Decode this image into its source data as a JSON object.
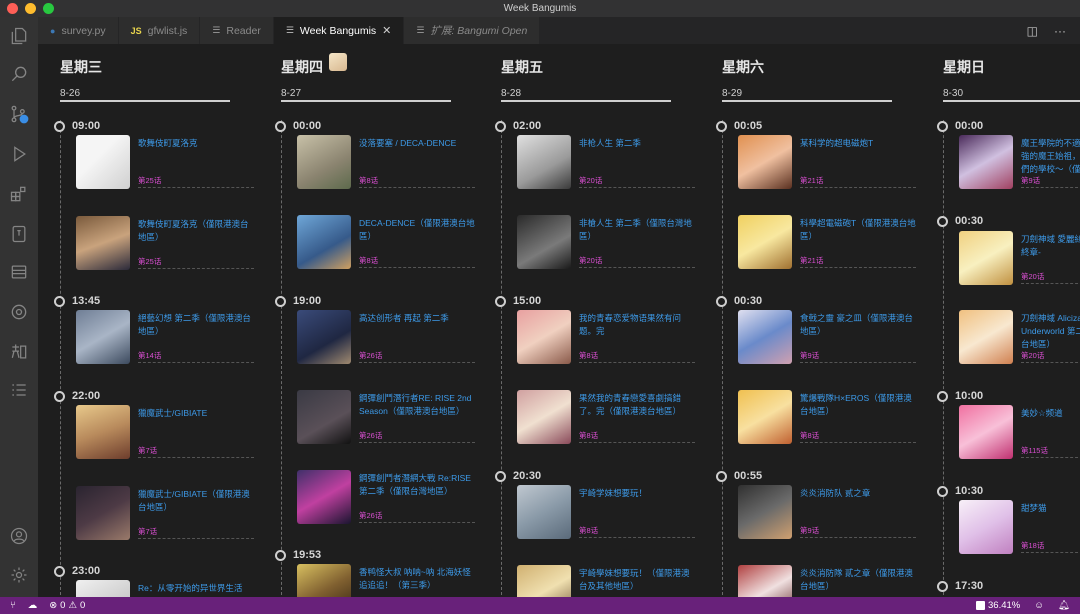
{
  "window": {
    "title": "Week Bangumis"
  },
  "tabs": [
    {
      "label": "survey.py",
      "icon": "python-icon",
      "active": false,
      "italic": false
    },
    {
      "label": "gfwlist.js",
      "icon_text": "JS",
      "active": false,
      "italic": false
    },
    {
      "label": "Reader",
      "icon": "preview-icon",
      "active": false,
      "italic": false
    },
    {
      "label": "Week Bangumis",
      "icon": "preview-icon",
      "active": true,
      "italic": false
    },
    {
      "label": "扩展: Bangumi Open",
      "icon": "preview-icon",
      "active": false,
      "italic": true
    }
  ],
  "days": [
    {
      "name": "星期三",
      "date": "8-26",
      "slots": [
        {
          "time": "09:00",
          "entries": [
            {
              "title": "歌舞伎町夏洛克",
              "ep": "第25话",
              "cover": "c1"
            },
            {
              "title": "歌舞伎町夏洛克（僅限港澳台地區）",
              "ep": "第25话",
              "cover": "c2"
            }
          ]
        },
        {
          "time": "13:45",
          "entries": [
            {
              "title": "絕藝幻想 第二季（僅限港澳台地區）",
              "ep": "第14话",
              "cover": "c3"
            }
          ]
        },
        {
          "time": "22:00",
          "entries": [
            {
              "title": "獵魔武士/GIBIATE",
              "ep": "第7话",
              "cover": "c4"
            },
            {
              "title": "獵魔武士/GIBIATE（僅限港澳台地區）",
              "ep": "第7话",
              "cover": "c5"
            }
          ]
        },
        {
          "time": "23:00",
          "entries": [
            {
              "title": "Re：从零开始的异世界生活",
              "ep": "",
              "cover": "c31"
            }
          ]
        }
      ]
    },
    {
      "name": "星期四",
      "date": "8-27",
      "slots": [
        {
          "time": "00:00",
          "entries": [
            {
              "title": "没落要塞 / DECA-DENCE",
              "ep": "第8话",
              "cover": "c6"
            },
            {
              "title": "DECA-DENCE（僅限港澳台地區）",
              "ep": "第8话",
              "cover": "c7"
            }
          ]
        },
        {
          "time": "19:00",
          "entries": [
            {
              "title": "高达创形者 再起 第二季",
              "ep": "第26话",
              "cover": "c8"
            },
            {
              "title": "鋼彈創鬥潛行者RE: RISE 2nd Season（僅限港澳台地區）",
              "ep": "第26话",
              "cover": "c9"
            },
            {
              "title": "鋼彈創鬥者潛網大戰 Re:RISE 第二季（僅限台灣地區）",
              "ep": "第26话",
              "cover": "c10"
            }
          ]
        },
        {
          "time": "19:53",
          "entries": [
            {
              "title": "香鸭怪大叔 呐呐~呐 北海妖怪追追追！（第三季）",
              "ep": "",
              "cover": "c30"
            }
          ]
        }
      ]
    },
    {
      "name": "星期五",
      "date": "8-28",
      "slots": [
        {
          "time": "02:00",
          "entries": [
            {
              "title": "非枪人生 第二季",
              "ep": "第20话",
              "cover": "c12"
            },
            {
              "title": "非槍人生 第二季（僅限台灣地區）",
              "ep": "第20话",
              "cover": "c13"
            }
          ]
        },
        {
          "time": "15:00",
          "entries": [
            {
              "title": "我的青春恋爱物语果然有问题。完",
              "ep": "第8话",
              "cover": "c14"
            },
            {
              "title": "果然我的青春戀愛喜劇搞錯了。完（僅限港澳台地區）",
              "ep": "第8话",
              "cover": "c15"
            }
          ]
        },
        {
          "time": "20:30",
          "entries": [
            {
              "title": "宇崎学妹想要玩！",
              "ep": "第8话",
              "cover": "c16"
            },
            {
              "title": "宇崎學妹想要玩！（僅限港澳台及其他地區）",
              "ep": "",
              "cover": "c17"
            }
          ]
        }
      ]
    },
    {
      "name": "星期六",
      "date": "8-29",
      "slots": [
        {
          "time": "00:05",
          "entries": [
            {
              "title": "某科学的超电磁炮T",
              "ep": "第21话",
              "cover": "c18"
            },
            {
              "title": "科學超電磁砲T（僅限港澳台地區）",
              "ep": "第21话",
              "cover": "c19"
            }
          ]
        },
        {
          "time": "00:30",
          "entries": [
            {
              "title": "食戟之靈 豪之皿（僅限港澳台地區）",
              "ep": "第9话",
              "cover": "c20"
            },
            {
              "title": "驚爆戰隊H×EROS（僅限港澳台地區）",
              "ep": "第8话",
              "cover": "c21"
            }
          ]
        },
        {
          "time": "00:55",
          "entries": [
            {
              "title": "炎炎消防队 贰之章",
              "ep": "第9话",
              "cover": "c22"
            },
            {
              "title": "炎炎消防隊 貳之章（僅限港澳台地區）",
              "ep": "",
              "cover": "c23"
            }
          ]
        }
      ]
    },
    {
      "name": "星期日",
      "date": "8-30",
      "slots": [
        {
          "time": "00:00",
          "entries": [
            {
              "title": "魔王學院的不適任者～史上最強的魔王始祖，轉生就讀子孫們的學校～（僅限港澳台地區）",
              "ep": "第9话",
              "cover": "c24"
            }
          ]
        },
        {
          "time": "00:30",
          "entries": [
            {
              "title": "刀劍神域 愛麗絲篇 異界戰爭 -終章-",
              "ep": "第20话",
              "cover": "c25"
            },
            {
              "title": "刀劍神域 Alicization War of Underworld 第二季（僅限港澳台地區）",
              "ep": "第20话",
              "cover": "c26"
            }
          ]
        },
        {
          "time": "10:00",
          "entries": [
            {
              "title": "美妙☆频道",
              "ep": "第115话",
              "cover": "c27"
            }
          ]
        },
        {
          "time": "10:30",
          "entries": [
            {
              "title": "甜梦猫",
              "ep": "第18话",
              "cover": "c28"
            }
          ]
        },
        {
          "time": "17:30",
          "entries": []
        }
      ]
    }
  ],
  "statusbar": {
    "errors": "0",
    "warnings": "0",
    "zoom": "36.41%"
  },
  "colors": {
    "title_link": "#3d9ae8",
    "episode": "#d94fd1",
    "statusbar": "#68217a"
  }
}
